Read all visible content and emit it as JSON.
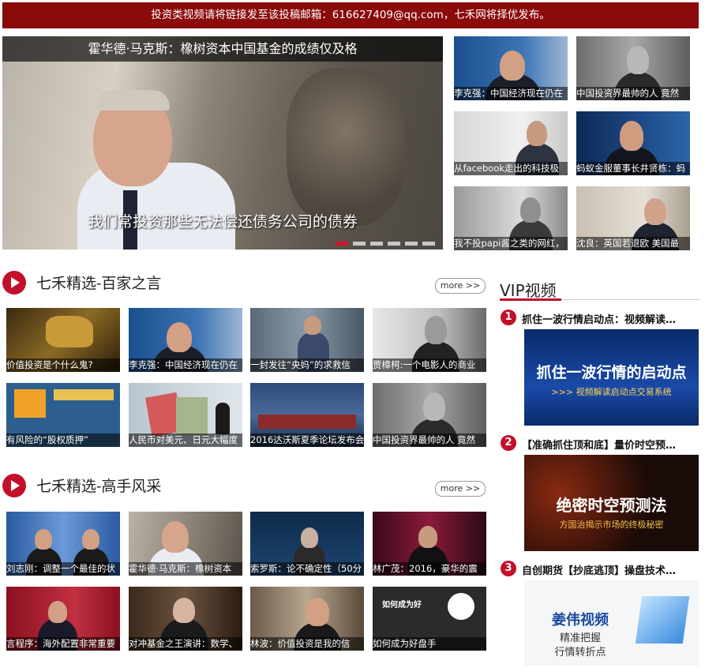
{
  "banner": "投资类视频请将链接发至该投稿邮箱：616627409@qq.com，七禾网将择优发布。",
  "hero": {
    "title": "霍华德·马克斯：橡树资本中国基金的成绩仅及格",
    "subtitle": "我们常投资那些无法偿还债务公司的债券",
    "active_slide": 1,
    "slide_count": 6
  },
  "side_videos": [
    {
      "caption": "李克强：中国经济现在仍在"
    },
    {
      "caption": "中国投资界最帅的人 竟然"
    },
    {
      "caption": "从facebook走出的科技极"
    },
    {
      "caption": "蚂蚁金服董事长井贤栋：蚂"
    },
    {
      "caption": "我不投papi酱之类的网红，"
    },
    {
      "caption": "沈良：英国若退欧 美国最"
    }
  ],
  "section1": {
    "title": "七禾精选-百家之言",
    "more": "more >>",
    "videos": [
      {
        "caption": "价值投资是个什么鬼?"
      },
      {
        "caption": "李克强：中国经济现在仍在"
      },
      {
        "caption": "一封发往“央妈”的求救信"
      },
      {
        "caption": "贾樟柯:一个电影人的商业"
      },
      {
        "caption": "有风险的“股权质押”"
      },
      {
        "caption": "人民币对美元、日元大幅度"
      },
      {
        "caption": "2016达沃斯夏季论坛发布会"
      },
      {
        "caption": "中国投资界最帅的人 竟然"
      }
    ]
  },
  "section2": {
    "title": "七禾精选-高手风采",
    "more": "more >>",
    "videos": [
      {
        "caption": "刘志刚：调整一个最佳的状"
      },
      {
        "caption": "霍华德·马克斯：橡树资本"
      },
      {
        "caption": "索罗斯：论不确定性（50分"
      },
      {
        "caption": "林广茂：2016，豪华的震"
      },
      {
        "caption": "言程序：海外配置非常重要"
      },
      {
        "caption": "对冲基金之王演讲：数学、"
      },
      {
        "caption": "林波：价值投资是我的信"
      },
      {
        "caption": "如何成为好盘手"
      }
    ]
  },
  "vip": {
    "title": "VIP视频",
    "items": [
      {
        "num": "1",
        "title": "抓住一波行情启动点：视频解读…",
        "ad_line1": "抓住一波行情的启动点",
        "ad_line2": ">>> 视频解读启动点交易系统"
      },
      {
        "num": "2",
        "title": "【准确抓住顶和底】量价时空预…",
        "ad_line1": "绝密时空预测法",
        "ad_line2": "方国治揭示市场的终极秘密"
      },
      {
        "num": "3",
        "title": "自创期货【抄底逃顶】操盘技术…",
        "ad_line1": "姜伟视频",
        "ad_line2": "精准把握",
        "ad_line3": "行情转折点"
      }
    ]
  }
}
